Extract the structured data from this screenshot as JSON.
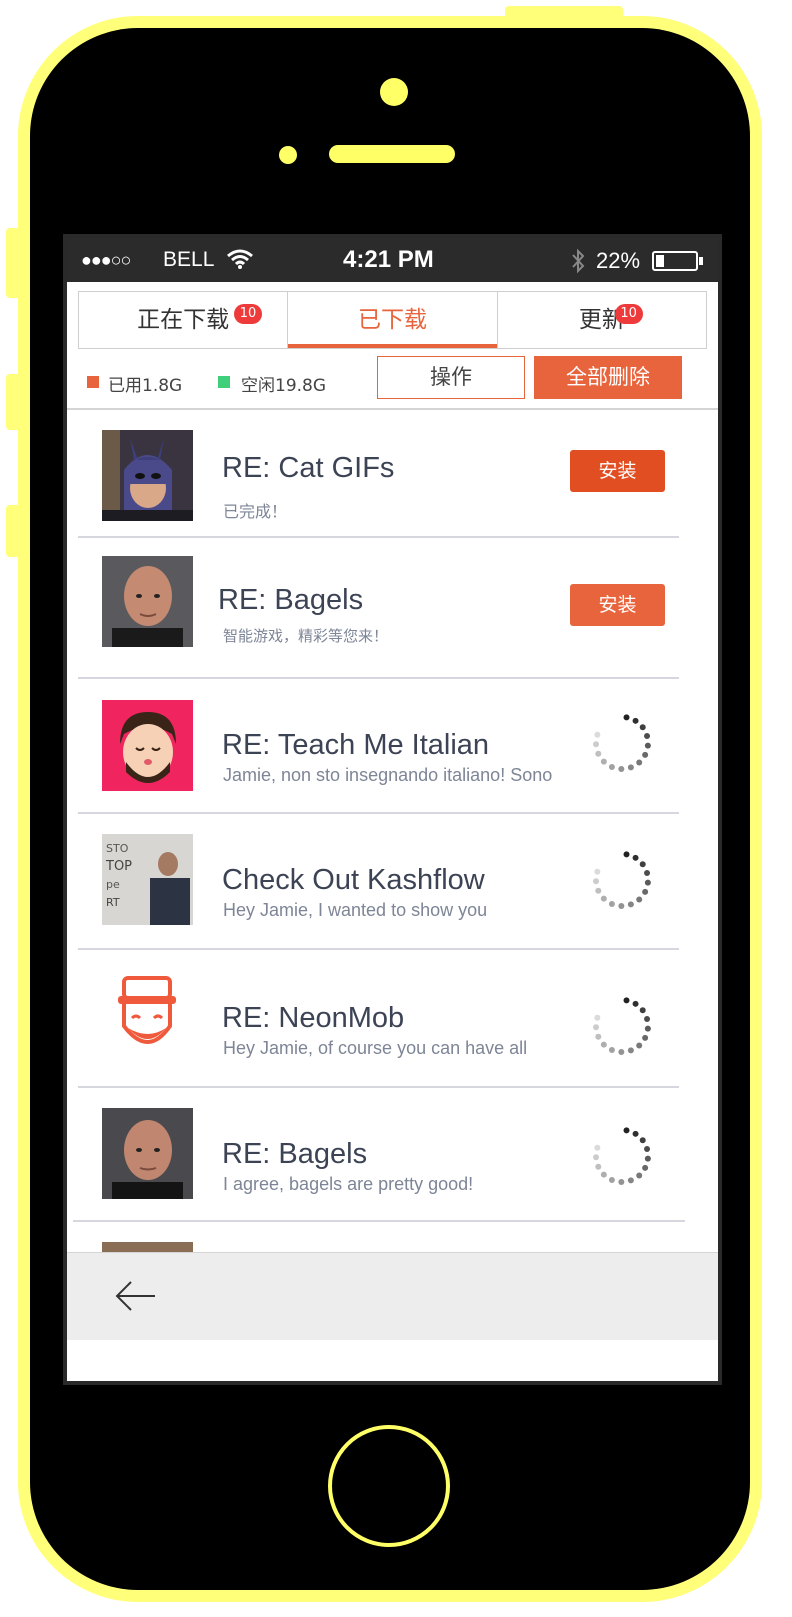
{
  "status_bar": {
    "signal": "●●●○○",
    "carrier": "BELL",
    "time": "4:21 PM",
    "battery": "22%",
    "battery_level": 0.22
  },
  "tabs": [
    {
      "label": "正在下载",
      "badge": "10",
      "active": false
    },
    {
      "label": "已下载",
      "badge": "",
      "active": true
    },
    {
      "label": "更新",
      "badge": "10",
      "active": false
    }
  ],
  "storage": {
    "used_label": "已用1.8G",
    "free_label": "空闲19.8G",
    "used_color": "#e8643c",
    "free_color": "#3fcf7a"
  },
  "actions": {
    "operate_label": "操作",
    "delete_all_label": "全部删除"
  },
  "items": [
    {
      "title": "RE: Cat GIFs",
      "subtitle": "已完成！",
      "action": "安装",
      "avatar": "masked-hero-photo"
    },
    {
      "title": "RE: Bagels",
      "subtitle": "智能游戏，精彩等您来！",
      "action": "安装",
      "avatar": "bald-man-photo"
    },
    {
      "title": "RE: Teach Me Italian",
      "subtitle": "Jamie, non sto insegnando italiano! Sono",
      "action": "loading",
      "avatar": "cartoon-man-pink"
    },
    {
      "title": "Check Out Kashflow",
      "subtitle": "Hey Jamie, I wanted to show you",
      "action": "loading",
      "avatar": "man-graffiti-photo"
    },
    {
      "title": "RE: NeonMob",
      "subtitle": "Hey Jamie, of course you can have all",
      "action": "loading",
      "avatar": "bearded-mascot-red"
    },
    {
      "title": "RE: Bagels",
      "subtitle": "I agree, bagels are pretty good!",
      "action": "loading",
      "avatar": "bald-man-photo"
    }
  ],
  "colors": {
    "accent": "#e8643c",
    "badge": "#ee3a3a",
    "phone_frame": "#ffff7a"
  },
  "icons": {
    "back": "back-arrow-icon",
    "wifi": "wifi-icon",
    "bluetooth": "bluetooth-icon",
    "battery": "battery-icon"
  }
}
